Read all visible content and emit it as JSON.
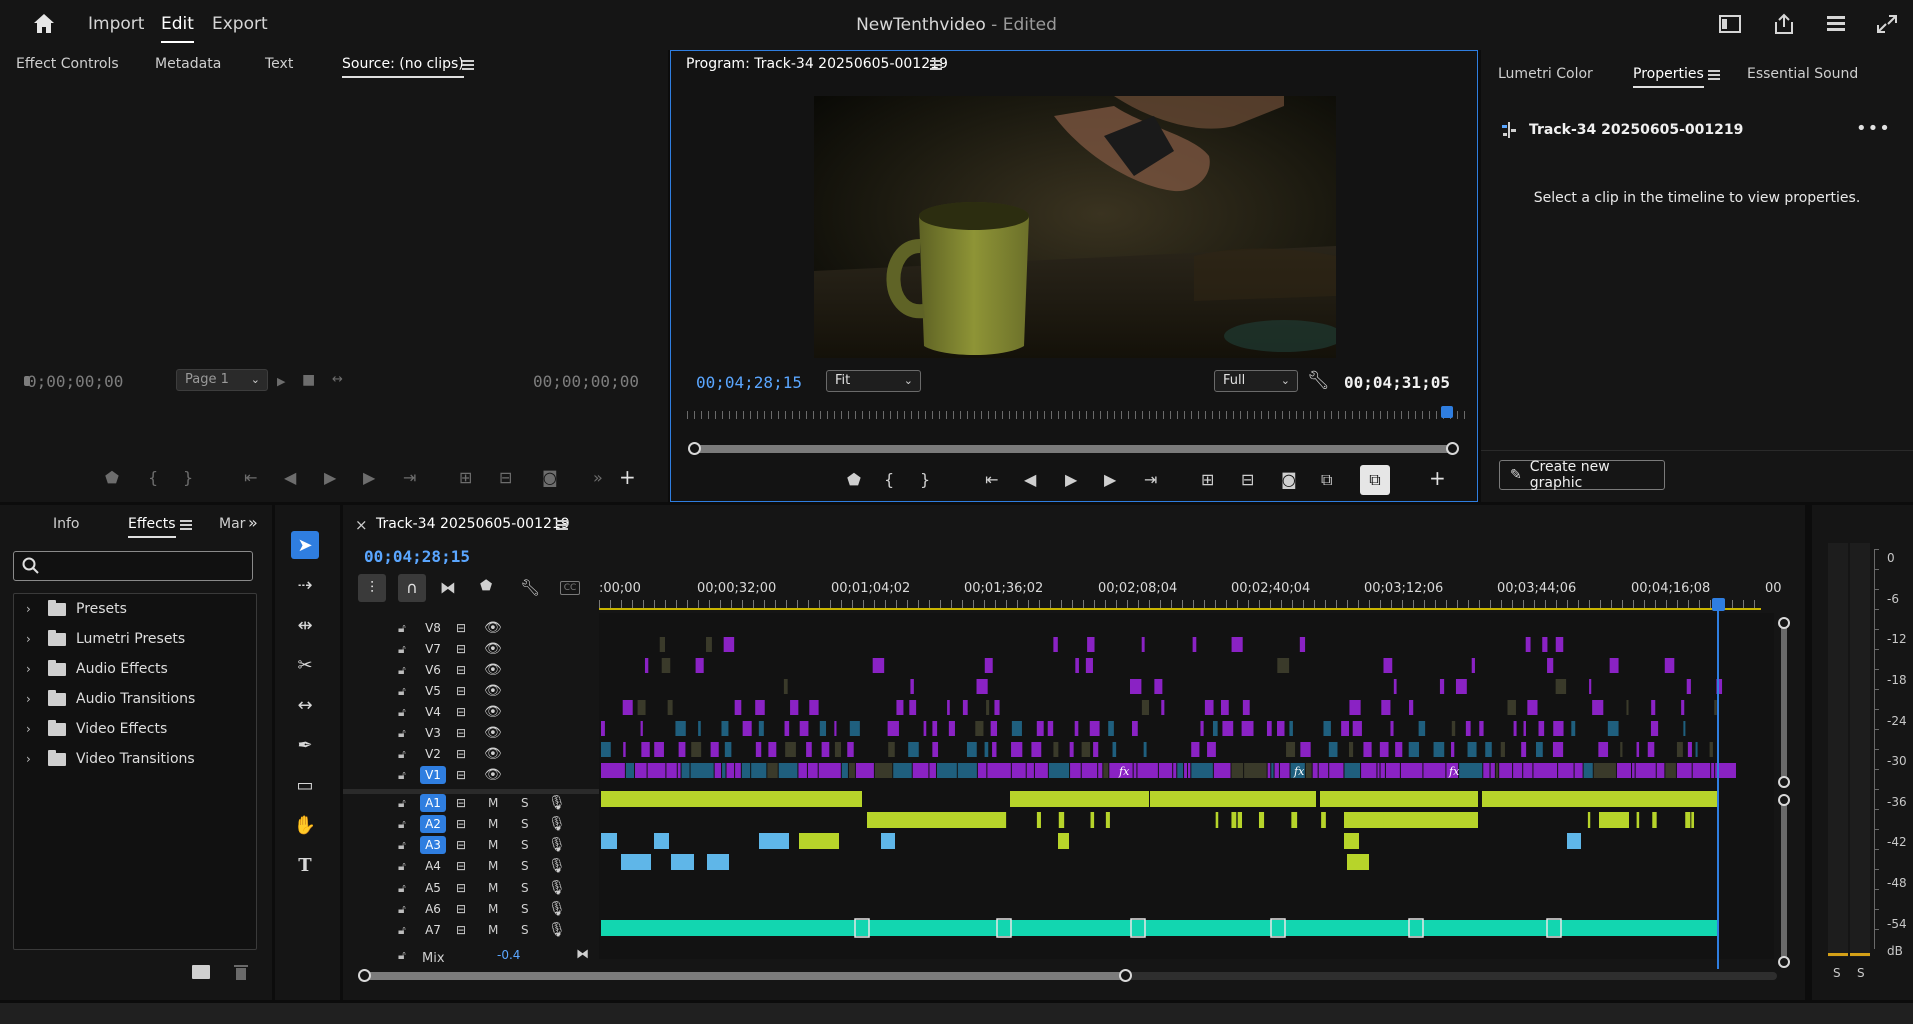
{
  "app": {
    "nav": {
      "import": "Import",
      "edit": "Edit",
      "export": "Export"
    },
    "project_title": "NewTenthvideo",
    "project_suffix": " - Edited"
  },
  "source_panel": {
    "tabs": [
      "Effect Controls",
      "Metadata",
      "Text",
      "Source: (no clips)"
    ],
    "timecode_left": "0;00;00;00",
    "timecode_right": "00;00;00;00",
    "page_select": "Page 1"
  },
  "program_panel": {
    "title": "Program: Track-34 20250605-001219",
    "timecode_current": "00;04;28;15",
    "timecode_duration": "00;04;31;05",
    "fit_select": "Fit",
    "quality_select": "Full"
  },
  "right_panel": {
    "tabs": [
      "Lumetri Color",
      "Properties",
      "Essential Sound"
    ],
    "sequence_name": "Track-34 20250605-001219",
    "empty_message": "Select a clip in the timeline to view properties.",
    "create_graphic_label": "Create new graphic"
  },
  "effects_panel": {
    "tabs": [
      "Info",
      "Effects",
      "Mar"
    ],
    "search_placeholder": "",
    "tree": [
      "Presets",
      "Lumetri Presets",
      "Audio Effects",
      "Audio Transitions",
      "Video Effects",
      "Video Transitions"
    ]
  },
  "timeline": {
    "sequence_tab": "Track-34 20250605-001219",
    "close_glyph": "×",
    "timecode": "00;04;28;15",
    "ruler_labels": [
      ":00;00",
      "00;00;32;00",
      "00;01;04;02",
      "00;01;36;02",
      "00;02;08;04",
      "00;02;40;04",
      "00;03;12;06",
      "00;03;44;06",
      "00;04;16;08",
      "00"
    ],
    "video_tracks": [
      "V8",
      "V7",
      "V6",
      "V5",
      "V4",
      "V3",
      "V2",
      "V1"
    ],
    "audio_tracks": [
      "A1",
      "A2",
      "A3",
      "A4",
      "A5",
      "A6",
      "A7"
    ],
    "targeted": [
      "V1",
      "A1",
      "A2",
      "A3"
    ],
    "m_label": "M",
    "s_label": "S",
    "mix_label": "Mix",
    "mix_value": "-0.4",
    "fx_label": "fx",
    "playhead_fraction": 0.985
  },
  "meter": {
    "labels": [
      "0",
      "-6",
      "-12",
      "-18",
      "-24",
      "-30",
      "-36",
      "-42",
      "-48",
      "-54",
      "dB"
    ],
    "solo_labels": [
      "S",
      "S"
    ]
  },
  "colors": {
    "accent": "#2f7ee0",
    "timecode_blue": "#5aa6ff",
    "video_clip": "#8a22c4",
    "video_clip_alt": "#1f5f7e",
    "audio_clip": "#b7d42a",
    "audio_clip_a3": "#5fb6e8",
    "audio_clip_a7": "#12d6b0"
  }
}
